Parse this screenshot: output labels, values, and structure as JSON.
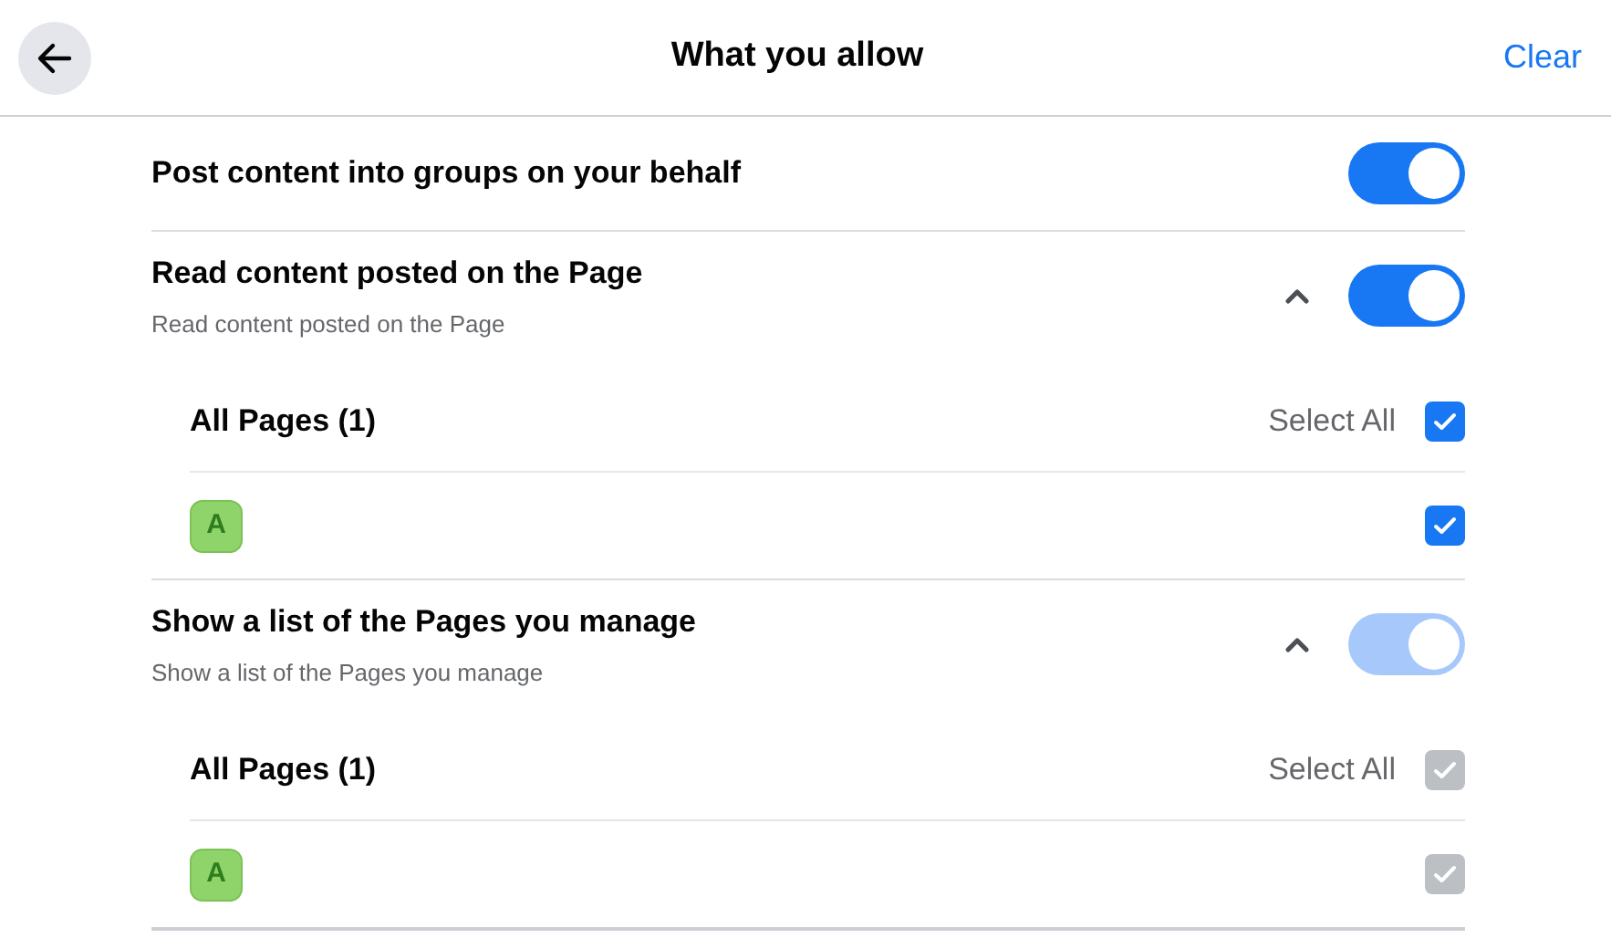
{
  "header": {
    "title": "What you allow",
    "clear": "Clear"
  },
  "permissions": [
    {
      "title": "Post content into groups on your behalf",
      "on": true,
      "disabled": false
    },
    {
      "title": "Read content posted on the Page",
      "description": "Read content posted on the Page",
      "expanded": true,
      "on": true,
      "disabled": false,
      "pages": {
        "label": "All Pages (1)",
        "select_all": "Select All",
        "all_checked": true,
        "items": [
          {
            "initial": "A",
            "checked": true
          }
        ]
      }
    },
    {
      "title": "Show a list of the Pages you manage",
      "description": "Show a list of the Pages you manage",
      "expanded": true,
      "on": true,
      "disabled": true,
      "pages": {
        "label": "All Pages (1)",
        "select_all": "Select All",
        "all_checked": true,
        "items": [
          {
            "initial": "A",
            "checked": true
          }
        ]
      }
    }
  ]
}
